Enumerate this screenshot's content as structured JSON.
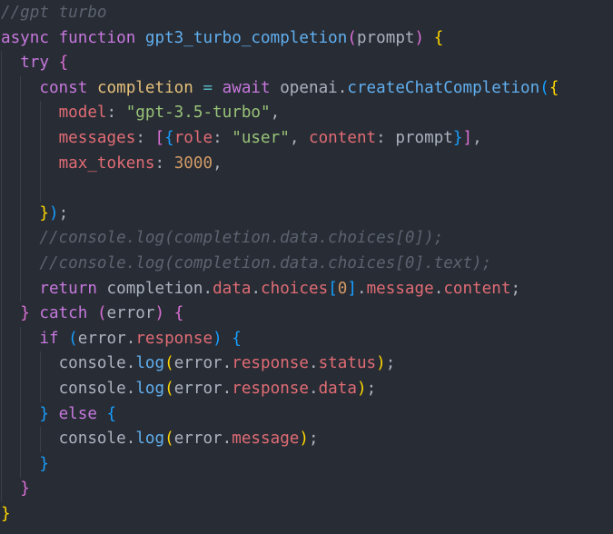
{
  "editor": {
    "language": "javascript",
    "lines": [
      [
        {
          "t": "//gpt turbo",
          "c": "comment"
        }
      ],
      [
        {
          "t": "async",
          "c": "keyword"
        },
        {
          "t": " ",
          "c": "plain"
        },
        {
          "t": "function",
          "c": "keyword"
        },
        {
          "t": " ",
          "c": "plain"
        },
        {
          "t": "gpt3_turbo_completion",
          "c": "func"
        },
        {
          "t": "(",
          "c": "brace-p"
        },
        {
          "t": "prompt",
          "c": "plain"
        },
        {
          "t": ")",
          "c": "brace-p"
        },
        {
          "t": " ",
          "c": "plain"
        },
        {
          "t": "{",
          "c": "brace-y"
        }
      ],
      [
        {
          "t": "  ",
          "c": "plain"
        },
        {
          "t": "try",
          "c": "keyword"
        },
        {
          "t": " ",
          "c": "plain"
        },
        {
          "t": "{",
          "c": "brace-p"
        }
      ],
      [
        {
          "t": "    ",
          "c": "plain"
        },
        {
          "t": "const",
          "c": "keyword"
        },
        {
          "t": " ",
          "c": "plain"
        },
        {
          "t": "completion",
          "c": "var"
        },
        {
          "t": " ",
          "c": "plain"
        },
        {
          "t": "=",
          "c": "op"
        },
        {
          "t": " ",
          "c": "plain"
        },
        {
          "t": "await",
          "c": "keyword"
        },
        {
          "t": " ",
          "c": "plain"
        },
        {
          "t": "openai",
          "c": "plain"
        },
        {
          "t": ".",
          "c": "plain"
        },
        {
          "t": "createChatCompletion",
          "c": "func"
        },
        {
          "t": "(",
          "c": "brace-b"
        },
        {
          "t": "{",
          "c": "brace-y"
        }
      ],
      [
        {
          "t": "      ",
          "c": "plain"
        },
        {
          "t": "model",
          "c": "prop"
        },
        {
          "t": ": ",
          "c": "plain"
        },
        {
          "t": "\"gpt-3.5-turbo\"",
          "c": "string"
        },
        {
          "t": ",",
          "c": "plain"
        }
      ],
      [
        {
          "t": "      ",
          "c": "plain"
        },
        {
          "t": "messages",
          "c": "prop"
        },
        {
          "t": ": ",
          "c": "plain"
        },
        {
          "t": "[",
          "c": "brace-p"
        },
        {
          "t": "{",
          "c": "brace-b"
        },
        {
          "t": "role",
          "c": "prop"
        },
        {
          "t": ": ",
          "c": "plain"
        },
        {
          "t": "\"user\"",
          "c": "string"
        },
        {
          "t": ", ",
          "c": "plain"
        },
        {
          "t": "content",
          "c": "prop"
        },
        {
          "t": ": ",
          "c": "plain"
        },
        {
          "t": "prompt",
          "c": "plain"
        },
        {
          "t": "}",
          "c": "brace-b"
        },
        {
          "t": "]",
          "c": "brace-p"
        },
        {
          "t": ",",
          "c": "plain"
        }
      ],
      [
        {
          "t": "      ",
          "c": "plain"
        },
        {
          "t": "max_tokens",
          "c": "prop"
        },
        {
          "t": ": ",
          "c": "plain"
        },
        {
          "t": "3000",
          "c": "number"
        },
        {
          "t": ",",
          "c": "plain"
        }
      ],
      [
        {
          "t": "",
          "c": "plain"
        }
      ],
      [
        {
          "t": "    ",
          "c": "plain"
        },
        {
          "t": "}",
          "c": "brace-y"
        },
        {
          "t": ")",
          "c": "brace-b"
        },
        {
          "t": ";",
          "c": "plain"
        }
      ],
      [
        {
          "t": "    ",
          "c": "plain"
        },
        {
          "t": "//console.log(completion.data.choices[0]);",
          "c": "comment"
        }
      ],
      [
        {
          "t": "    ",
          "c": "plain"
        },
        {
          "t": "//console.log(completion.data.choices[0].text);",
          "c": "comment"
        }
      ],
      [
        {
          "t": "    ",
          "c": "plain"
        },
        {
          "t": "return",
          "c": "keyword"
        },
        {
          "t": " ",
          "c": "plain"
        },
        {
          "t": "completion",
          "c": "plain"
        },
        {
          "t": ".",
          "c": "plain"
        },
        {
          "t": "data",
          "c": "prop"
        },
        {
          "t": ".",
          "c": "plain"
        },
        {
          "t": "choices",
          "c": "prop"
        },
        {
          "t": "[",
          "c": "brace-b"
        },
        {
          "t": "0",
          "c": "number"
        },
        {
          "t": "]",
          "c": "brace-b"
        },
        {
          "t": ".",
          "c": "plain"
        },
        {
          "t": "message",
          "c": "prop"
        },
        {
          "t": ".",
          "c": "plain"
        },
        {
          "t": "content",
          "c": "prop"
        },
        {
          "t": ";",
          "c": "plain"
        }
      ],
      [
        {
          "t": "  ",
          "c": "plain"
        },
        {
          "t": "}",
          "c": "brace-p"
        },
        {
          "t": " ",
          "c": "plain"
        },
        {
          "t": "catch",
          "c": "keyword"
        },
        {
          "t": " ",
          "c": "plain"
        },
        {
          "t": "(",
          "c": "brace-p"
        },
        {
          "t": "error",
          "c": "plain"
        },
        {
          "t": ")",
          "c": "brace-p"
        },
        {
          "t": " ",
          "c": "plain"
        },
        {
          "t": "{",
          "c": "brace-p"
        }
      ],
      [
        {
          "t": "    ",
          "c": "plain"
        },
        {
          "t": "if",
          "c": "keyword"
        },
        {
          "t": " ",
          "c": "plain"
        },
        {
          "t": "(",
          "c": "brace-b"
        },
        {
          "t": "error",
          "c": "plain"
        },
        {
          "t": ".",
          "c": "plain"
        },
        {
          "t": "response",
          "c": "prop"
        },
        {
          "t": ")",
          "c": "brace-b"
        },
        {
          "t": " ",
          "c": "plain"
        },
        {
          "t": "{",
          "c": "brace-b"
        }
      ],
      [
        {
          "t": "      ",
          "c": "plain"
        },
        {
          "t": "console",
          "c": "plain"
        },
        {
          "t": ".",
          "c": "plain"
        },
        {
          "t": "log",
          "c": "func"
        },
        {
          "t": "(",
          "c": "brace-y"
        },
        {
          "t": "error",
          "c": "plain"
        },
        {
          "t": ".",
          "c": "plain"
        },
        {
          "t": "response",
          "c": "prop"
        },
        {
          "t": ".",
          "c": "plain"
        },
        {
          "t": "status",
          "c": "prop"
        },
        {
          "t": ")",
          "c": "brace-y"
        },
        {
          "t": ";",
          "c": "plain"
        }
      ],
      [
        {
          "t": "      ",
          "c": "plain"
        },
        {
          "t": "console",
          "c": "plain"
        },
        {
          "t": ".",
          "c": "plain"
        },
        {
          "t": "log",
          "c": "func"
        },
        {
          "t": "(",
          "c": "brace-y"
        },
        {
          "t": "error",
          "c": "plain"
        },
        {
          "t": ".",
          "c": "plain"
        },
        {
          "t": "response",
          "c": "prop"
        },
        {
          "t": ".",
          "c": "plain"
        },
        {
          "t": "data",
          "c": "prop"
        },
        {
          "t": ")",
          "c": "brace-y"
        },
        {
          "t": ";",
          "c": "plain"
        }
      ],
      [
        {
          "t": "    ",
          "c": "plain"
        },
        {
          "t": "}",
          "c": "brace-b"
        },
        {
          "t": " ",
          "c": "plain"
        },
        {
          "t": "else",
          "c": "keyword"
        },
        {
          "t": " ",
          "c": "plain"
        },
        {
          "t": "{",
          "c": "brace-b"
        }
      ],
      [
        {
          "t": "      ",
          "c": "plain"
        },
        {
          "t": "console",
          "c": "plain"
        },
        {
          "t": ".",
          "c": "plain"
        },
        {
          "t": "log",
          "c": "func"
        },
        {
          "t": "(",
          "c": "brace-y"
        },
        {
          "t": "error",
          "c": "plain"
        },
        {
          "t": ".",
          "c": "plain"
        },
        {
          "t": "message",
          "c": "prop"
        },
        {
          "t": ")",
          "c": "brace-y"
        },
        {
          "t": ";",
          "c": "plain"
        }
      ],
      [
        {
          "t": "    ",
          "c": "plain"
        },
        {
          "t": "}",
          "c": "brace-b"
        }
      ],
      [
        {
          "t": "  ",
          "c": "plain"
        },
        {
          "t": "}",
          "c": "brace-p"
        }
      ],
      [
        {
          "t": "}",
          "c": "brace-y"
        }
      ]
    ]
  },
  "theme": {
    "background": "#282c34",
    "comment": "#5c6370",
    "keyword": "#c678dd",
    "function": "#61afef",
    "variable": "#e5c07b",
    "property": "#e06c75",
    "string": "#98c379",
    "number": "#d19a66",
    "plain": "#abb2bf"
  }
}
